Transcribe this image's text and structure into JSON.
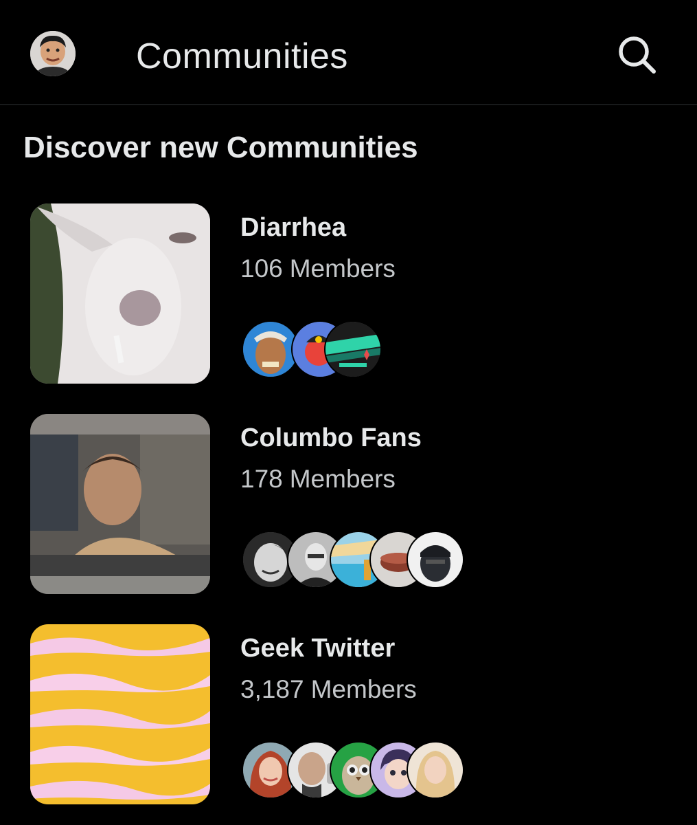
{
  "header": {
    "title": "Communities",
    "avatar_icon": "user-avatar",
    "search_icon": "search-icon"
  },
  "section": {
    "title": "Discover new Communities"
  },
  "communities": [
    {
      "name": "Diarrhea",
      "member_count": "106",
      "member_label": "Members",
      "member_avatars": 3
    },
    {
      "name": "Columbo Fans",
      "member_count": "178",
      "member_label": "Members",
      "member_avatars": 5
    },
    {
      "name": "Geek Twitter",
      "member_count": "3,187",
      "member_label": "Members",
      "member_avatars": 5
    }
  ],
  "colors": {
    "background": "#000000",
    "text_primary": "#e7e9ea",
    "text_secondary": "#c4c7ca",
    "divider": "#2f3336"
  }
}
